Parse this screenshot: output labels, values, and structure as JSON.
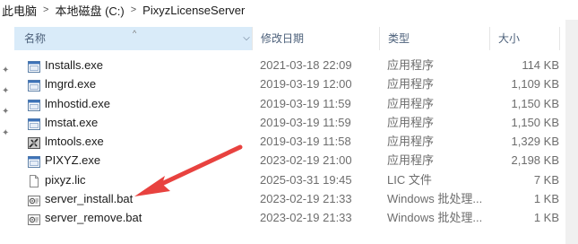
{
  "breadcrumb": [
    "此电脑",
    "本地磁盘 (C:)",
    "PixyzLicenseServer"
  ],
  "columns": {
    "name": "名称",
    "date": "修改日期",
    "type": "类型",
    "size": "大小"
  },
  "files": [
    {
      "name": "Installs.exe",
      "date": "2021-03-18 22:09",
      "type": "应用程序",
      "size": "114 KB",
      "icon": "exe-window-icon"
    },
    {
      "name": "lmgrd.exe",
      "date": "2019-03-19 12:00",
      "type": "应用程序",
      "size": "1,109 KB",
      "icon": "exe-window-icon"
    },
    {
      "name": "lmhostid.exe",
      "date": "2019-03-19 11:59",
      "type": "应用程序",
      "size": "1,150 KB",
      "icon": "exe-window-icon"
    },
    {
      "name": "lmstat.exe",
      "date": "2019-03-19 11:59",
      "type": "应用程序",
      "size": "1,150 KB",
      "icon": "exe-window-icon"
    },
    {
      "name": "lmtools.exe",
      "date": "2019-03-19 11:58",
      "type": "应用程序",
      "size": "1,329 KB",
      "icon": "tools-app-icon"
    },
    {
      "name": "PIXYZ.exe",
      "date": "2023-02-19 21:00",
      "type": "应用程序",
      "size": "2,198 KB",
      "icon": "exe-window-icon"
    },
    {
      "name": "pixyz.lic",
      "date": "2025-03-31 19:45",
      "type": "LIC 文件",
      "size": "7 KB",
      "icon": "blank-file-icon"
    },
    {
      "name": "server_install.bat",
      "date": "2023-02-19 21:33",
      "type": "Windows 批处理...",
      "size": "1 KB",
      "icon": "batch-file-icon"
    },
    {
      "name": "server_remove.bat",
      "date": "2023-02-19 21:33",
      "type": "Windows 批处理...",
      "size": "1 KB",
      "icon": "batch-file-icon"
    }
  ],
  "colors": {
    "header_selected": "#d9ebf9",
    "header_text": "#4c607a",
    "meta_text": "#6d6d6d",
    "annotation_arrow": "#e8423f"
  }
}
